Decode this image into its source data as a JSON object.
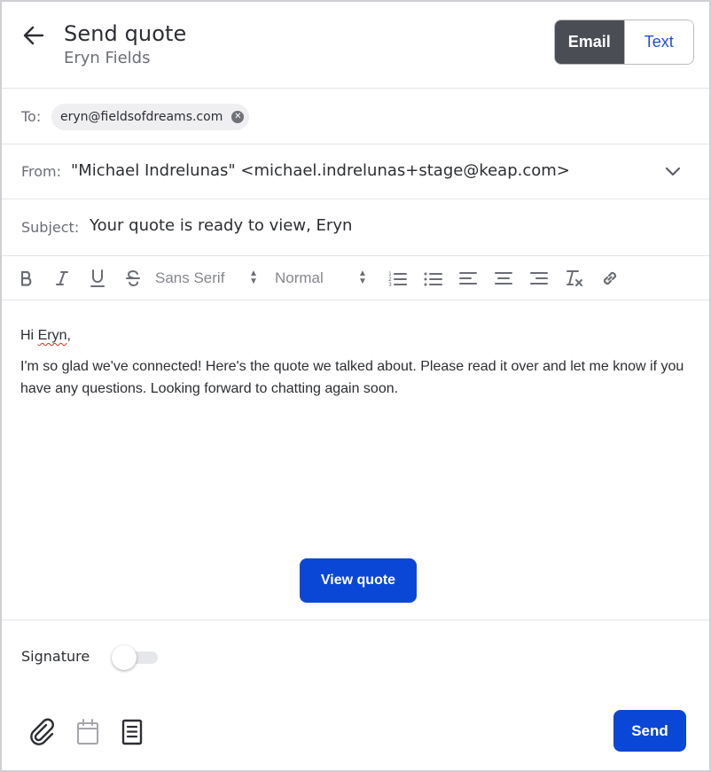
{
  "header": {
    "title": "Send quote",
    "subtitle": "Eryn Fields",
    "back_icon": "arrow-left-icon",
    "mode_toggle": {
      "options": [
        "Email",
        "Text"
      ],
      "selected": "Email"
    }
  },
  "to": {
    "label": "To:",
    "recipients": [
      {
        "email": "eryn@fieldsofdreams.com",
        "remove_icon": "close-circle-icon"
      }
    ]
  },
  "from": {
    "label": "From:",
    "value": "\"Michael Indrelunas\" <michael.indrelunas+stage@keap.com>",
    "dropdown_icon": "chevron-down-icon"
  },
  "subject": {
    "label": "Subject:",
    "value": "Your quote is ready to view, Eryn"
  },
  "toolbar": {
    "buttons": [
      "bold-icon",
      "italic-icon",
      "underline-icon",
      "strikethrough-icon",
      "ordered-list-icon",
      "bullet-list-icon",
      "align-left-icon",
      "align-center-icon",
      "align-right-icon",
      "clear-format-icon",
      "link-icon"
    ],
    "font_family": "Sans Serif",
    "font_size": "Normal"
  },
  "body": {
    "greeting_prefix": "Hi ",
    "greeting_name": "Eryn",
    "greeting_suffix": ",",
    "paragraph": "I'm so glad we've connected! Here's the quote we talked about. Please read it over and let me know if you have any questions. Looking forward to chatting again soon.",
    "cta_label": "View quote"
  },
  "signature": {
    "label": "Signature",
    "enabled": false
  },
  "footer": {
    "icons": [
      "paperclip-icon",
      "calendar-icon",
      "document-icon"
    ],
    "send_label": "Send"
  },
  "colors": {
    "primary": "#0a47d6",
    "toggle_active": "#4b4d55",
    "link_blue": "#1d4ed8"
  }
}
